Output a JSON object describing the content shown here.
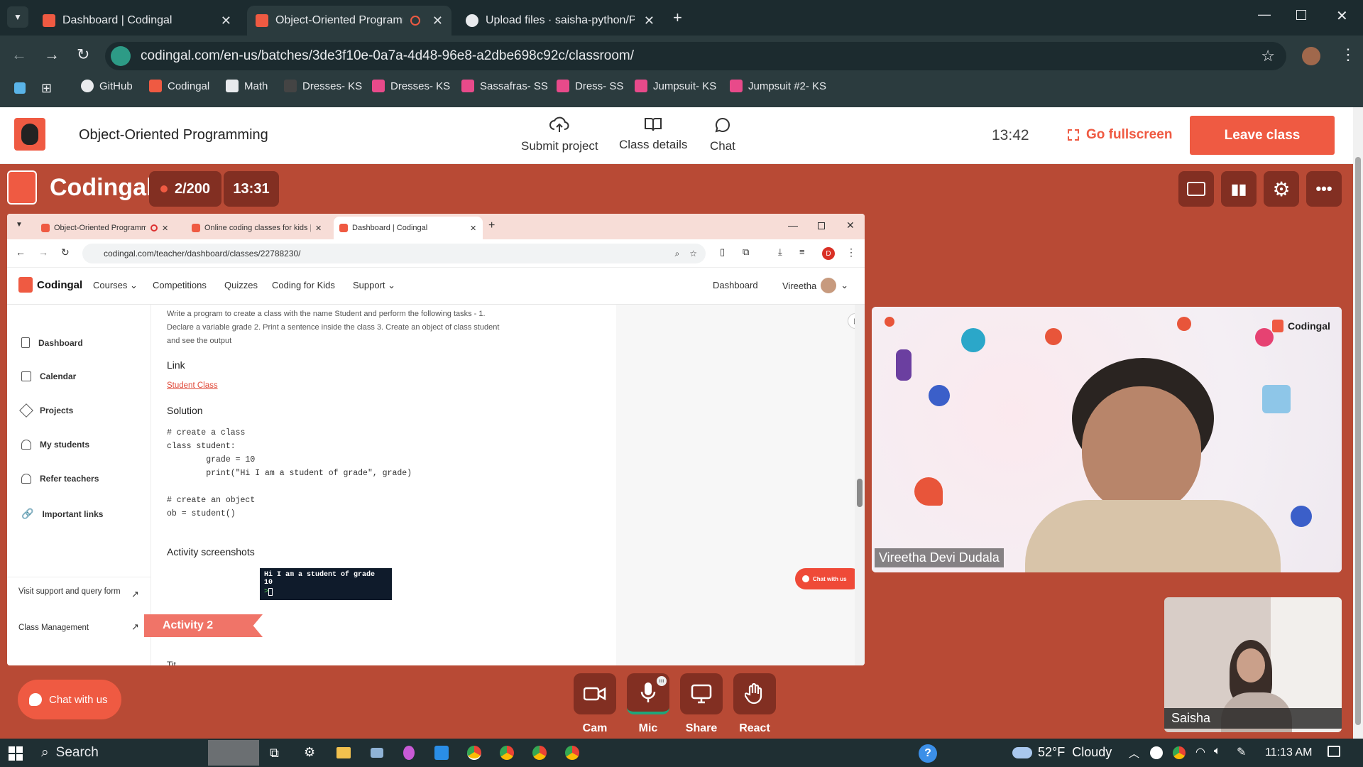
{
  "browser": {
    "tabs": [
      {
        "title": "Dashboard | Codingal"
      },
      {
        "title": "Object-Oriented Programm"
      },
      {
        "title": "Upload files · saisha-python/Py"
      }
    ],
    "url": "codingal.com/en-us/batches/3de3f10e-0a7a-4d48-96e8-a2dbe698c92c/classroom/",
    "bookmarks": [
      {
        "label": "GitHub"
      },
      {
        "label": "Codingal"
      },
      {
        "label": "Math"
      },
      {
        "label": "Dresses- KS"
      },
      {
        "label": "Dresses- KS"
      },
      {
        "label": "Sassafras- SS"
      },
      {
        "label": "Dress- SS"
      },
      {
        "label": "Jumpsuit- KS"
      },
      {
        "label": "Jumpsuit #2- KS"
      }
    ]
  },
  "header": {
    "class_title": "Object-Oriented Programming",
    "actions": [
      "Submit project",
      "Class details",
      "Chat"
    ],
    "clock": "13:42",
    "fullscreen_label": "Go fullscreen",
    "leave_label": "Leave class"
  },
  "classbar": {
    "brand": "Codingal",
    "participants": "2/200",
    "timer": "13:31"
  },
  "shared_screen": {
    "tabs": [
      {
        "title": "Object-Oriented Programm"
      },
      {
        "title": "Online coding classes for kids |"
      },
      {
        "title": "Dashboard | Codingal"
      }
    ],
    "url": "codingal.com/teacher/dashboard/classes/22788230/",
    "profile_letter": "D",
    "nav": {
      "brand": "Codingal",
      "items": [
        "Courses",
        "Competitions",
        "Quizzes",
        "Coding for Kids",
        "Support"
      ],
      "dashboard": "Dashboard",
      "user": "Vireetha"
    },
    "sidebar": {
      "items": [
        "Dashboard",
        "Calendar",
        "Projects",
        "My students",
        "Refer teachers",
        "Important links"
      ],
      "footer_links": [
        "Visit support and query form",
        "Class Management"
      ]
    },
    "content": {
      "intro_line1": "Write a program to create a class with the name Student and perform the following tasks - 1.",
      "intro_line2": "Declare a variable grade 2. Print a sentence inside the class 3. Create an object of class student",
      "intro_line3": "and see the output",
      "link_heading": "Link",
      "link_text": "Student Class",
      "solution_heading": "Solution",
      "code_lines": [
        "# create a class",
        "class student:",
        "        grade = 10",
        "        print(\"Hi I am a student of grade\", grade)",
        "",
        "# create an object",
        "ob = student()"
      ],
      "screenshots_heading": "Activity screenshots",
      "terminal_line1": "Hi I am a student of grade 10",
      "terminal_line2": "> ",
      "activity_banner": "Activity 2",
      "cut_text": "Tit"
    },
    "chat_button": "Chat with us"
  },
  "videos": {
    "teacher_name": "Vireetha Devi Dudala",
    "teacher_watermark": "Codingal",
    "student_name": "Saisha"
  },
  "controls": {
    "chat_with_us": "Chat with us",
    "buttons": [
      "Cam",
      "Mic",
      "Share",
      "React"
    ]
  },
  "taskbar": {
    "search": "Search",
    "weather": "52°F  Cloudy",
    "time": "11:13 AM"
  },
  "colors": {
    "brand": "#ef5a42",
    "stage_bg": "#b84a35",
    "dark_button": "#822f22",
    "chrome_dark": "#1c2b2f"
  }
}
